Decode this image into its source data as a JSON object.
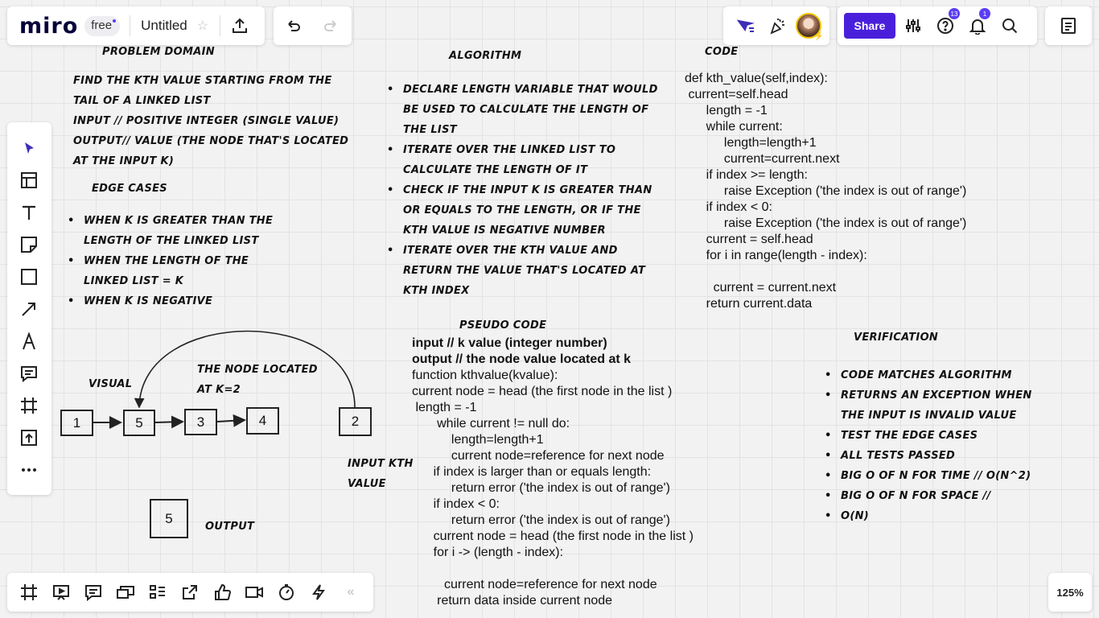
{
  "topbar": {
    "logo": "miro",
    "plan": "free",
    "board_title": "Untitled",
    "share_label": "Share",
    "help_badge": "13",
    "notif_badge": "1"
  },
  "zoom": "125%",
  "left_toolbar": [
    "select-icon",
    "templates-icon",
    "text-icon",
    "sticky-note-icon",
    "shape-icon",
    "arrow-icon",
    "pen-icon",
    "comment-icon",
    "frame-icon",
    "upload-icon",
    "more-icon"
  ],
  "bottom_toolbar": [
    "frames-icon",
    "presentation-icon",
    "comments-icon",
    "cards-icon",
    "kanban-icon",
    "share-screen-icon",
    "voting-icon",
    "video-icon",
    "timer-icon",
    "activity-icon",
    "collapse-icon"
  ],
  "board": {
    "problem": {
      "heading": "Problem domain",
      "lines": [
        "Find the kth value starting from the",
        "tail of a linked list",
        "input // positive integer (single value)",
        "output// value (the node that's located",
        "at the input k)"
      ]
    },
    "edge": {
      "heading": "Edge cases",
      "items": [
        "When k is greater than the length of the linked list",
        "when the length of the linked list = k",
        "when k is negative"
      ]
    },
    "algorithm": {
      "heading": "Algorithm",
      "items": [
        "declare length variable that would be used to calculate the length of the list",
        "iterate over the linked list to calculate the length of it",
        "check if the input k is greater than or equals to the length, or if the kth value is negative number",
        "iterate over the kth value and return the value that's located at kth index"
      ]
    },
    "code": {
      "heading": "Code",
      "lines": [
        "def kth_value(self,index):",
        " current=self.head",
        "      length = -1",
        "      while current:",
        "           length=length+1",
        "           current=current.next",
        "      if index >= length:",
        "           raise Exception ('the index is out of range')",
        "      if index < 0:",
        "           raise Exception ('the index is out of range')",
        "      current = self.head",
        "      for i in range(length - index):",
        "",
        "        current = current.next",
        "      return current.data"
      ]
    },
    "pseudo": {
      "heading": "Pseudo code",
      "bold_lines": [
        "input // k value (integer number)",
        "output // the node value located at k"
      ],
      "lines": [
        "function kthvalue(kvalue):",
        "current node = head (the first node in the list )",
        " length = -1",
        "       while current != null do:",
        "           length=length+1",
        "           current node=reference for next node",
        "      if index is larger than or equals length:",
        "           return error ('the index is out of range')",
        "      if index < 0:",
        "           return error ('the index is out of range')",
        "      current node = head (the first node in the list )",
        "      for i -> (length - index):",
        "",
        "         current node=reference for next node",
        "       return data inside current node"
      ]
    },
    "verification": {
      "heading": "Verification",
      "items": [
        "code matches algorithm",
        "returns an exception when the input is invalid value",
        "test the edge cases",
        "all tests passed",
        "Big O of n for time // O(n^2)",
        "Big O of n for space //",
        "O(n)"
      ]
    },
    "visual": {
      "label": "Visual",
      "node_label": "the node located at k=2",
      "nodes": [
        "1",
        "5",
        "3",
        "4"
      ],
      "input_value": "2",
      "input_label": "input kth value",
      "output_value": "5",
      "output_label": "output"
    }
  }
}
